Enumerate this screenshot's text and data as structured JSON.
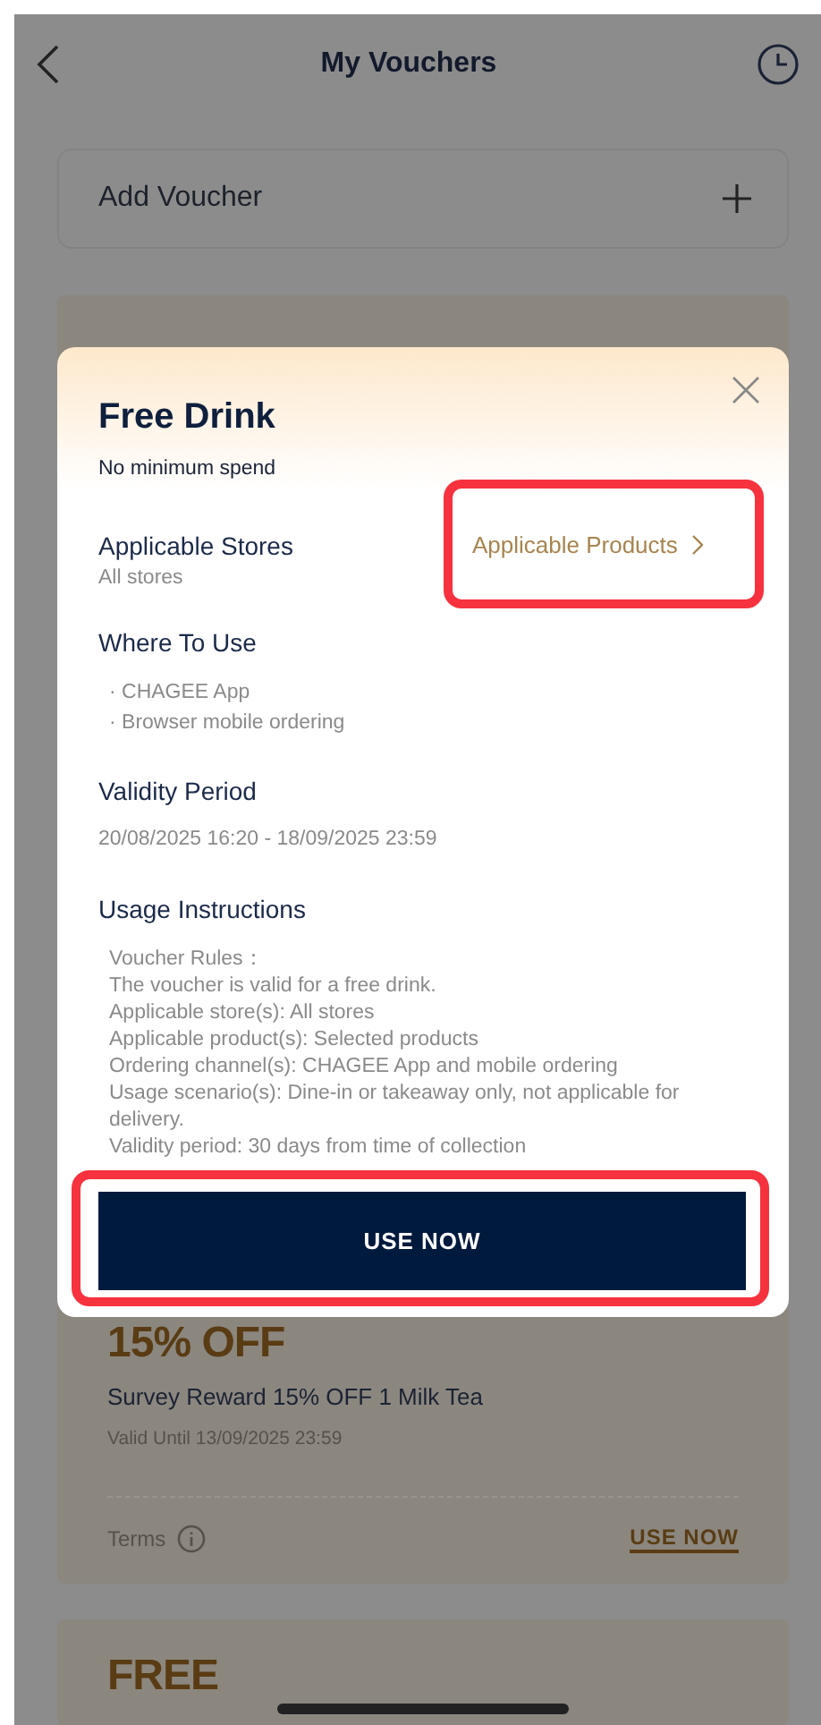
{
  "header": {
    "title": "My Vouchers"
  },
  "add_voucher": {
    "label": "Add Voucher"
  },
  "vouchers": [
    {
      "title": "15% OFF",
      "description": "Survey Reward 15% OFF 1 Milk Tea",
      "valid_until": "Valid Until 13/09/2025 23:59",
      "terms": "Terms",
      "action": "USE NOW"
    },
    {
      "title": "FREE"
    }
  ],
  "dialog": {
    "title": "Free Drink",
    "min_spend": "No minimum spend",
    "stores": {
      "label": "Applicable Stores",
      "value": "All stores"
    },
    "products_link": {
      "label": "Applicable Products",
      "highlighted": true
    },
    "where_to_use": {
      "label": "Where To Use",
      "items": [
        "· CHAGEE App",
        "· Browser mobile ordering"
      ]
    },
    "validity": {
      "label": "Validity Period",
      "value": "20/08/2025 16:20 - 18/09/2025 23:59"
    },
    "usage": {
      "label": "Usage Instructions",
      "lines": [
        "Voucher Rules：",
        "The voucher is valid for a free drink.",
        "Applicable store(s): All stores",
        "Applicable product(s): Selected products",
        "Ordering channel(s): CHAGEE App and mobile ordering",
        "Usage scenario(s): Dine-in or takeaway only, not applicable for delivery.",
        "Validity period: 30 days from time of collection"
      ]
    },
    "button": {
      "label": "USE NOW",
      "highlighted": true
    }
  }
}
